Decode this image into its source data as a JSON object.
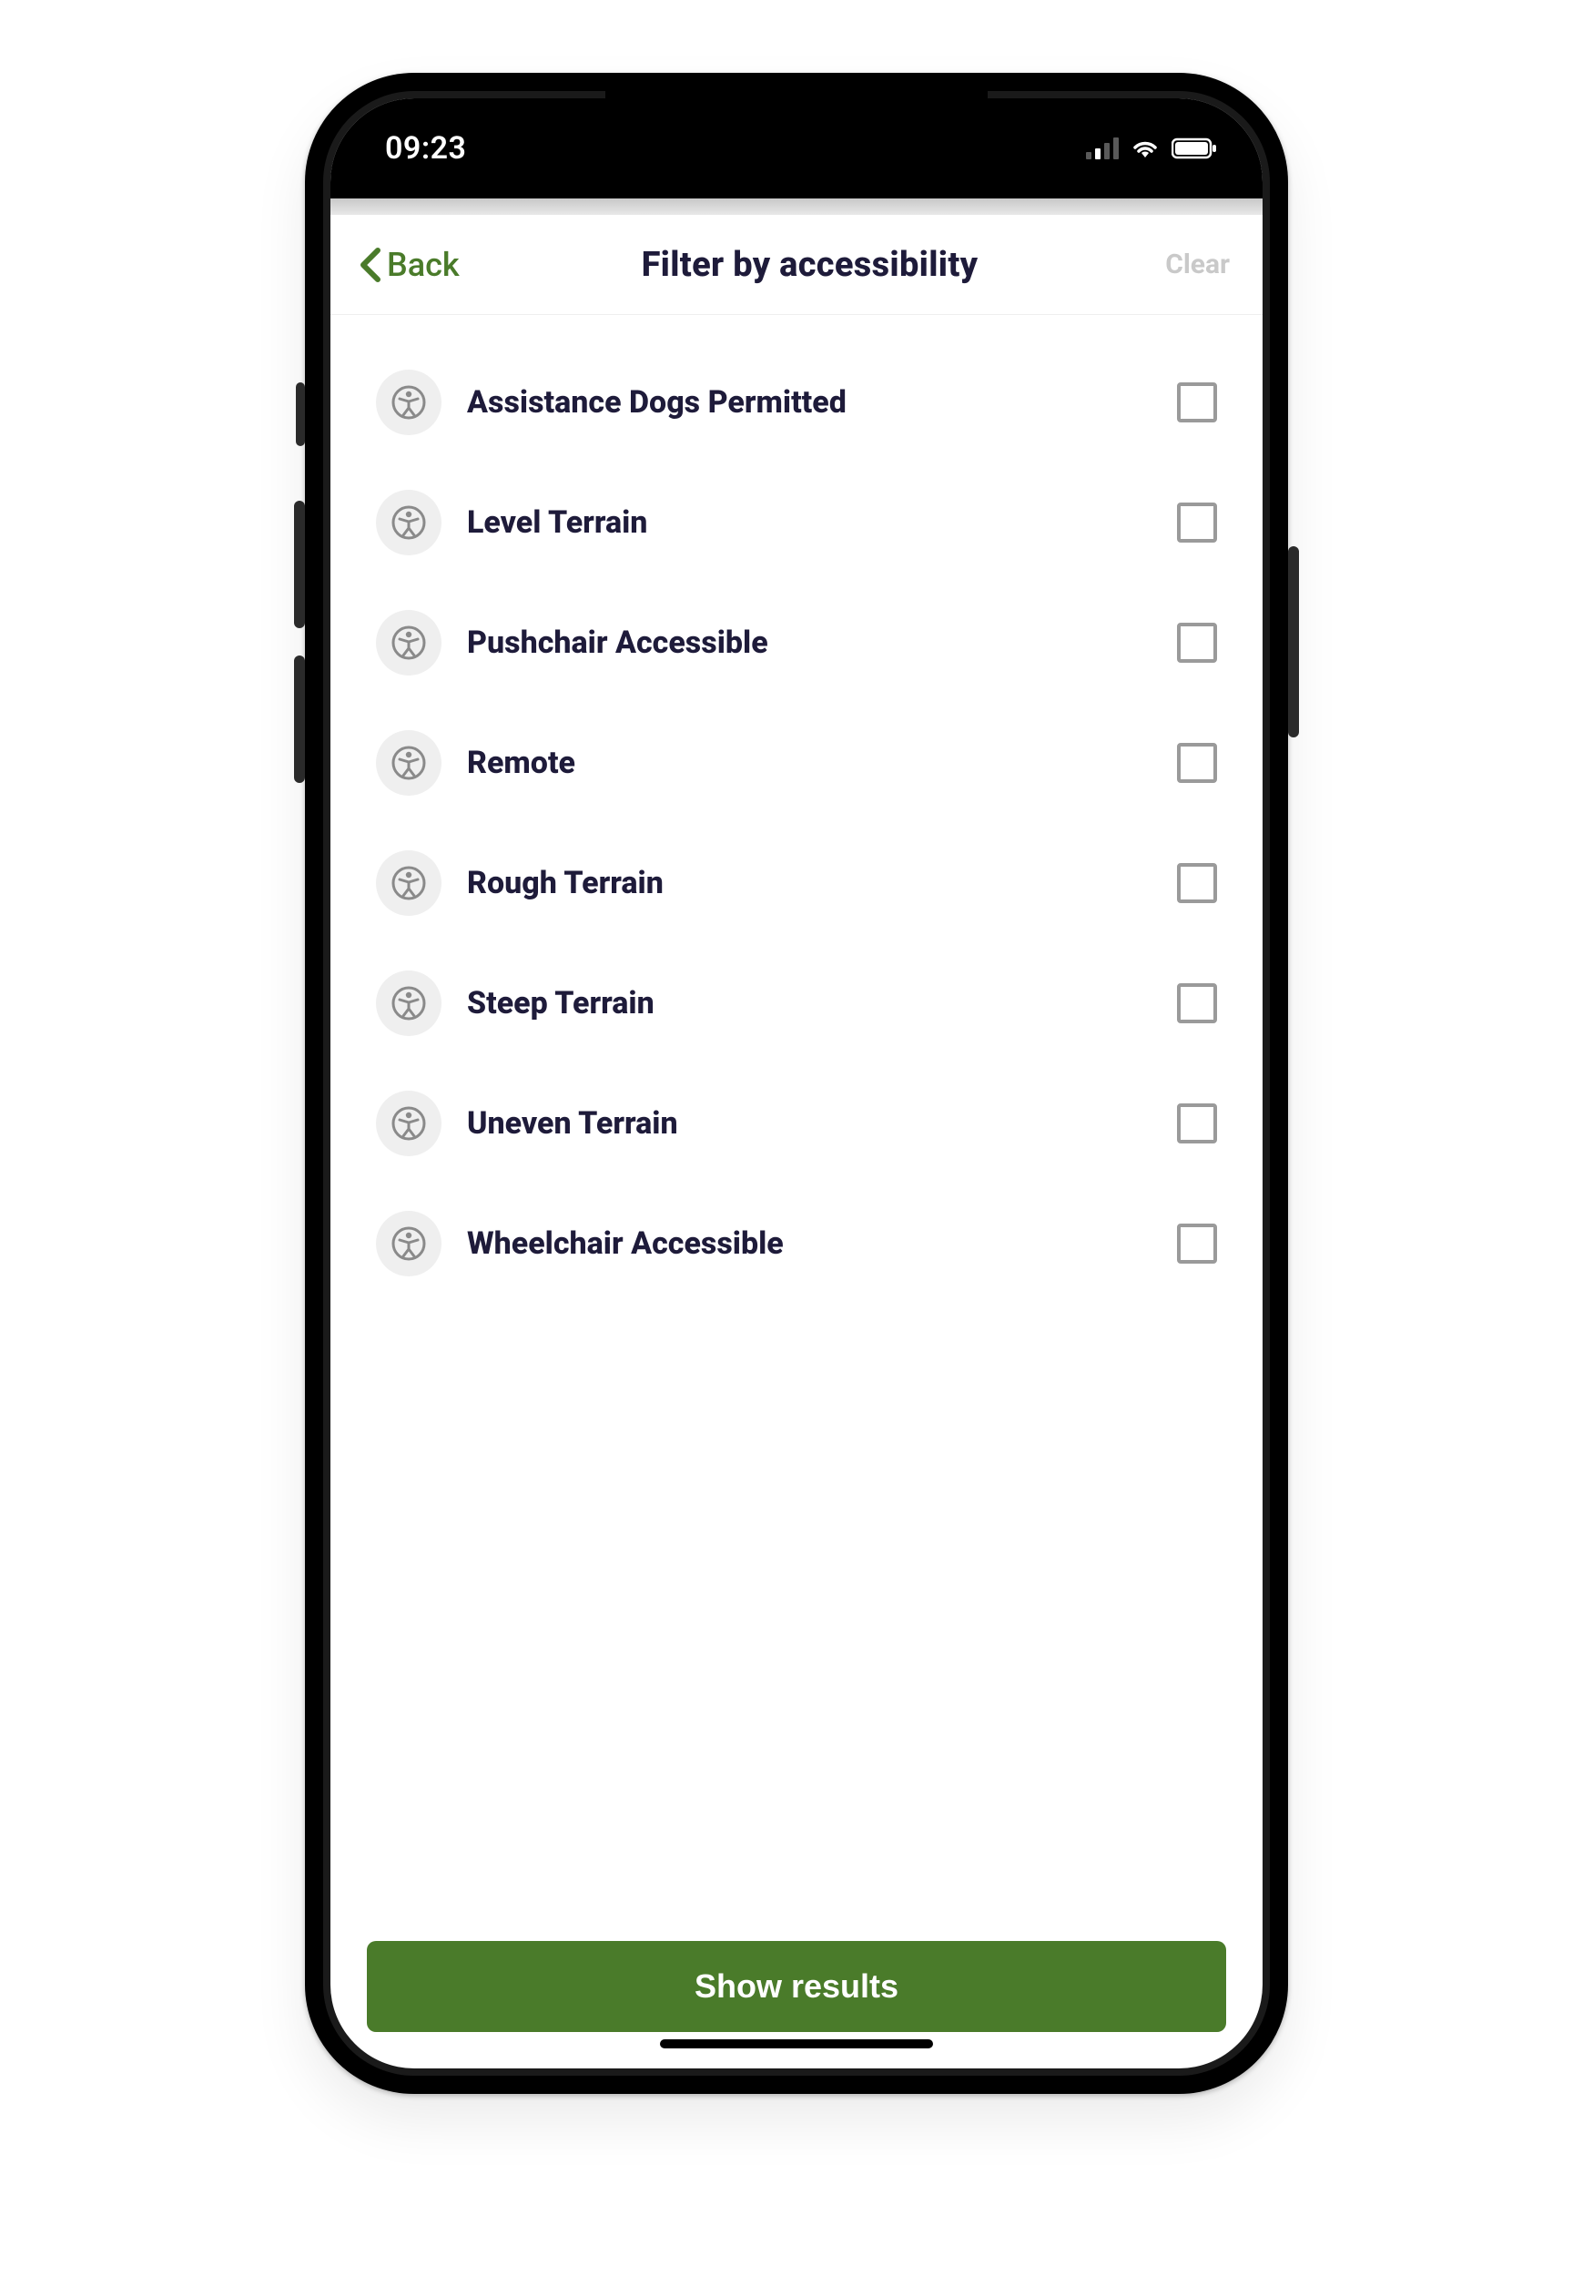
{
  "status_bar": {
    "time": "09:23"
  },
  "nav": {
    "back_label": "Back",
    "title": "Filter by accessibility",
    "clear_label": "Clear"
  },
  "filters": [
    {
      "label": "Assistance Dogs Permitted",
      "checked": false
    },
    {
      "label": "Level Terrain",
      "checked": false
    },
    {
      "label": "Pushchair Accessible",
      "checked": false
    },
    {
      "label": "Remote",
      "checked": false
    },
    {
      "label": "Rough Terrain",
      "checked": false
    },
    {
      "label": "Steep Terrain",
      "checked": false
    },
    {
      "label": "Uneven Terrain",
      "checked": false
    },
    {
      "label": "Wheelchair Accessible",
      "checked": false
    }
  ],
  "cta": {
    "show_results_label": "Show results"
  },
  "colors": {
    "accent": "#4a7b2a",
    "text_dark": "#1e1b3a",
    "icon_grey": "#8a8a8a",
    "checkbox_border": "#9a9a9a",
    "clear_disabled": "#c9c9c9"
  }
}
